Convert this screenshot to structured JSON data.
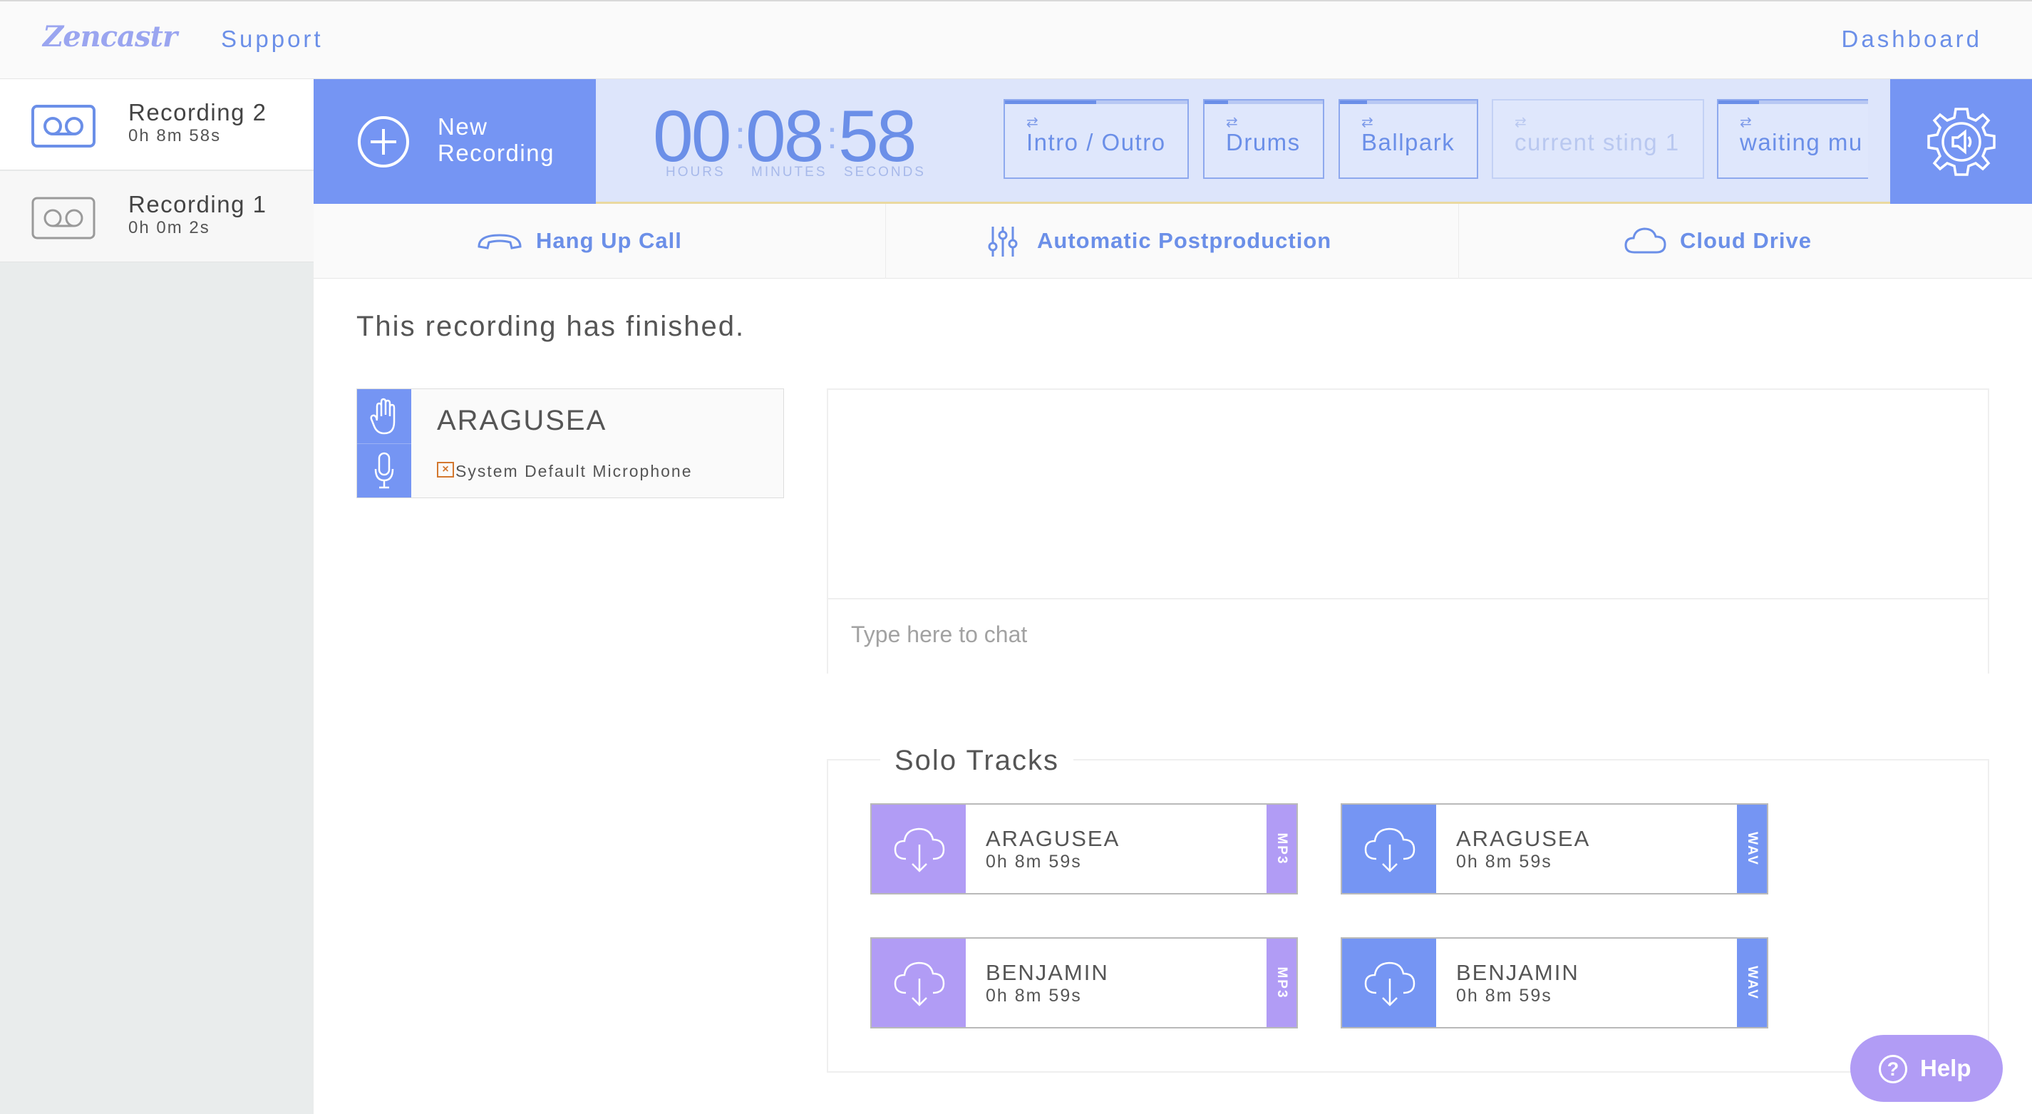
{
  "nav": {
    "logo": "Zencastr",
    "support": "Support",
    "dashboard": "Dashboard"
  },
  "sidebar": {
    "items": [
      {
        "name": "Recording 2",
        "duration": "0h 8m 58s",
        "active": true
      },
      {
        "name": "Recording 1",
        "duration": "0h 0m 2s",
        "active": false
      }
    ]
  },
  "control": {
    "new_recording_line1": "New",
    "new_recording_line2": "Recording",
    "timer": {
      "hours": "00",
      "minutes": "08",
      "seconds": "58",
      "hours_label": "HOURS",
      "minutes_label": "MINUTES",
      "seconds_label": "SECONDS"
    },
    "stings": [
      {
        "label": "Intro / Outro",
        "progress": 0.5,
        "enabled": true
      },
      {
        "label": "Drums",
        "progress": 0.2,
        "enabled": true
      },
      {
        "label": "Ballpark",
        "progress": 0.2,
        "enabled": true
      },
      {
        "label": "current sting 1",
        "progress": 0,
        "enabled": false
      },
      {
        "label": "waiting mu",
        "progress": 0.27,
        "enabled": true
      }
    ]
  },
  "actions": {
    "hang_up": "Hang Up Call",
    "postproduction": "Automatic Postproduction",
    "cloud_drive": "Cloud Drive"
  },
  "main": {
    "status": "This recording has finished.",
    "participant": {
      "name": "ARAGUSEA",
      "microphone": "System Default Microphone"
    },
    "chat_placeholder": "Type here to chat",
    "solo_title": "Solo Tracks",
    "tracks": [
      {
        "name": "ARAGUSEA",
        "duration": "0h 8m 59s",
        "format": "MP3"
      },
      {
        "name": "ARAGUSEA",
        "duration": "0h 8m 59s",
        "format": "WAV"
      },
      {
        "name": "BENJAMIN",
        "duration": "0h 8m 59s",
        "format": "MP3"
      },
      {
        "name": "BENJAMIN",
        "duration": "0h 8m 59s",
        "format": "WAV"
      }
    ]
  },
  "help": {
    "label": "Help",
    "glyph": "?"
  },
  "colors": {
    "primary": "#7595f3",
    "purple": "#b19cf5",
    "timer_bg": "#dde5fb",
    "text": "#555555",
    "warning": "#d3772e"
  }
}
